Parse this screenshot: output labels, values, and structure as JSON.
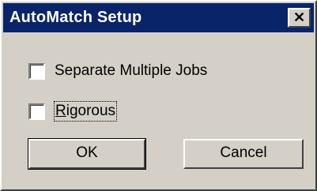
{
  "window": {
    "title": "AutoMatch Setup",
    "close_glyph": "✕",
    "titlebar_color": "#0a246a",
    "face_color": "#d4d0c8"
  },
  "options": [
    {
      "label": "Separate Multiple Jobs",
      "checked": false
    },
    {
      "label_first": "R",
      "label_rest": "igorous",
      "label": "Rigorous",
      "checked": false,
      "focused": true
    }
  ],
  "buttons": {
    "ok_label": "OK",
    "cancel_label": "Cancel"
  }
}
